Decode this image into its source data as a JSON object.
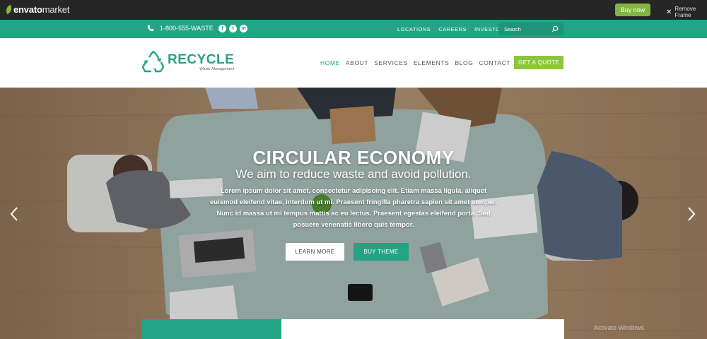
{
  "envato": {
    "logo_main": "envato",
    "logo_suffix": "market",
    "buy_now": "Buy now",
    "remove_frame": "Remove Frame"
  },
  "topbar": {
    "phone": "1-800-555-WASTE",
    "social_icons": [
      "facebook-icon",
      "twitter-icon",
      "linkedin-icon"
    ],
    "links": [
      "LOCATIONS",
      "CAREERS",
      "INVESTORS"
    ],
    "search_placeholder": "Search"
  },
  "header": {
    "logo_name": "RECYCLE",
    "logo_tagline": "Waste Management",
    "nav": [
      "HOME",
      "ABOUT",
      "SERVICES",
      "ELEMENTS",
      "BLOG",
      "CONTACT"
    ],
    "active_nav": "HOME",
    "quote_button": "GET A QUOTE"
  },
  "hero": {
    "title": "CIRCULAR ECONOMY",
    "subtitle": "We aim to reduce waste and avoid pollution.",
    "body": "Lorem ipsum dolor sit amet, consectetur adipiscing elit. Etiam massa ligula, aliquet euismod eleifend vitae, interdum ut mi. Praesent fringilla pharetra sapien sit amet semper. Nunc id massa ut mi tempus mattis ac eu lectus. Praesent egestas eleifend porta. Sed posuere venenatis libero quis tempor.",
    "learn_more": "LEARN MORE",
    "buy_theme": "BUY THEME",
    "watermark": "Activate Windows"
  },
  "colors": {
    "brand_green": "#23a484",
    "accent_lime": "#8cc63f",
    "envato_bar": "#262626"
  }
}
